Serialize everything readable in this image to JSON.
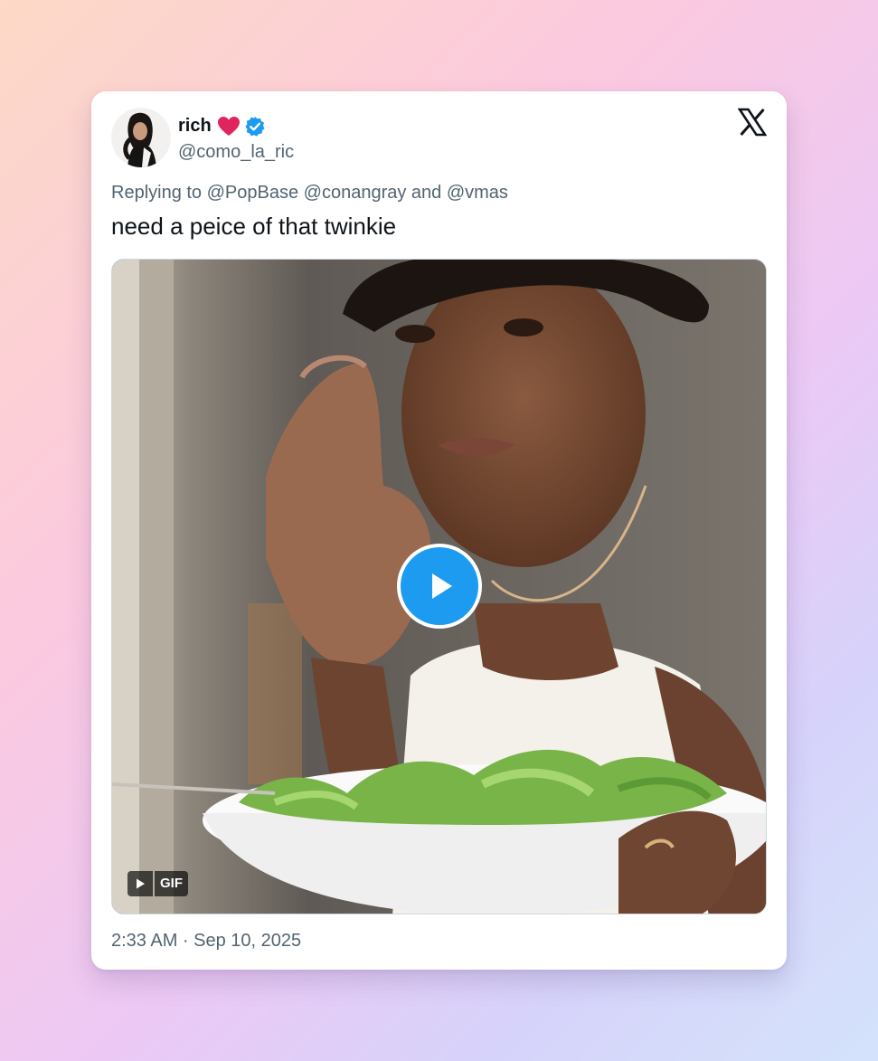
{
  "tweet": {
    "author": {
      "display_name": "rich",
      "handle": "@como_la_ric",
      "verified": true,
      "name_emoji": "heart-icon"
    },
    "replying_to": "Replying to @PopBase @conangray and @vmas",
    "text": "need a peice of that twinkie",
    "media": {
      "type": "gif",
      "badge_label": "GIF",
      "controls": "play-icon"
    },
    "timestamp": "2:33 AM · Sep 10, 2025"
  },
  "brand": {
    "logo": "x-logo-icon"
  },
  "colors": {
    "accent": "#1d9bf0",
    "text_primary": "#0f1419",
    "text_secondary": "#536471",
    "heart": "#e0245e",
    "card_background": "#ffffff"
  }
}
